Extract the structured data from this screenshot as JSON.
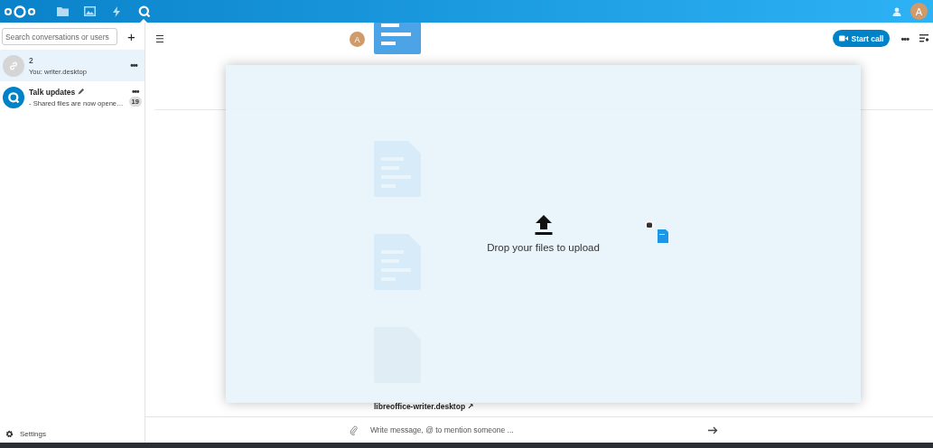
{
  "top_bar": {
    "apps": [
      {
        "kind": "files",
        "selected": false
      },
      {
        "kind": "photos",
        "selected": false
      },
      {
        "kind": "activity",
        "selected": false
      },
      {
        "kind": "talk",
        "selected": true
      }
    ],
    "user_avatar": "A"
  },
  "sidebar": {
    "search": {
      "placeholder": "Search conversations or users"
    },
    "conversations": [
      {
        "kind": "link",
        "name": "2",
        "preview": "You: writer.desktop",
        "menu": "•••",
        "selected": true
      },
      {
        "kind": "app",
        "name": "Talk updates",
        "preview": "- Shared files are now opene…",
        "menu": "•••",
        "unread": "19",
        "selected": false
      }
    ],
    "settings": "Settings",
    "new_button": "+"
  },
  "chat": {
    "menu_icon": "☰",
    "start_call": "Start call",
    "more": "•••",
    "messages": [
      {
        "kind": "document_cut",
        "avatar": "A"
      },
      {
        "kind": "date"
      },
      {
        "kind": "document"
      },
      {
        "kind": "document"
      },
      {
        "kind": "generic",
        "file_name": "libreoffice-writer.desktop ↗"
      }
    ],
    "input": {
      "placeholder": "Write message, @ to mention someone ..."
    }
  },
  "drop_overlay": {
    "text": "Drop your files to upload"
  }
}
